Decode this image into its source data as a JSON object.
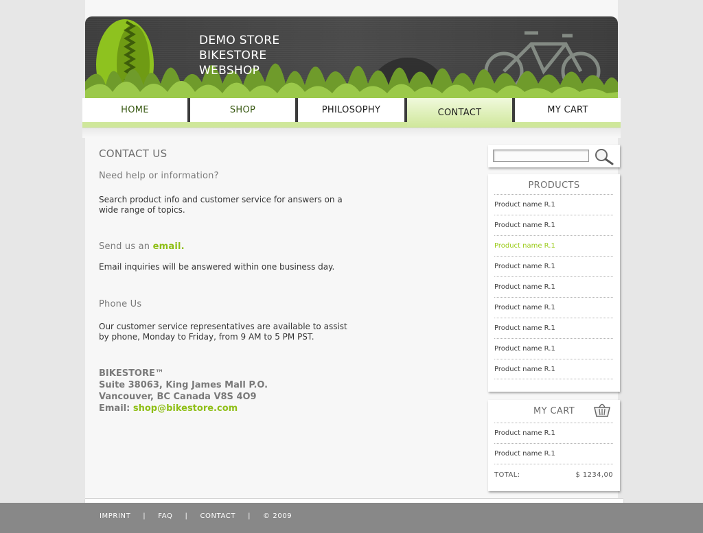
{
  "header": {
    "title_lines": [
      "DEMO STORE",
      "BIKESTORE",
      "WEBSHOP"
    ]
  },
  "nav": {
    "items": [
      {
        "label": "HOME"
      },
      {
        "label": "SHOP"
      },
      {
        "label": "PHILOSOPHY"
      },
      {
        "label": "CONTACT",
        "active": true
      },
      {
        "label": "MY CART"
      }
    ]
  },
  "main": {
    "title": "CONTACT US",
    "help_heading": "Need help or information?",
    "help_text": "Search product info and customer service for answers on a wide range of topics.",
    "email_heading_prefix": "Send us an",
    "email_heading_link": "email.",
    "email_text": "Email inquiries will be answered within one business day.",
    "phone_heading": "Phone Us",
    "phone_text": "Our customer service representatives are available to assist by phone, Monday to Friday, from 9 AM to 5 PM PST.",
    "address": {
      "company": "BIKESTORE™",
      "line1": "Suite 38063, King James Mall P.O.",
      "line2": "Vancouver, BC Canada V8S 4O9",
      "email_label": "Email:",
      "email": "shop@bikestore.com"
    }
  },
  "search": {
    "value": "",
    "icon": "magnifier-icon"
  },
  "products": {
    "title": "PRODUCTS",
    "items": [
      {
        "name": "Product name R.1"
      },
      {
        "name": "Product name R.1"
      },
      {
        "name": "Product name R.1",
        "highlight": true
      },
      {
        "name": "Product name R.1"
      },
      {
        "name": "Product name R.1"
      },
      {
        "name": "Product name R.1"
      },
      {
        "name": "Product name R.1"
      },
      {
        "name": "Product name R.1"
      },
      {
        "name": "Product name R.1"
      }
    ]
  },
  "cart": {
    "title": "MY CART",
    "icon": "basket-icon",
    "items": [
      {
        "name": "Product name R.1"
      },
      {
        "name": "Product name R.1"
      }
    ],
    "total_label": "TOTAL:",
    "total_value": "$ 1234,00"
  },
  "footer": {
    "links": [
      "IMPRINT",
      "FAQ",
      "CONTACT"
    ],
    "copyright": "© 2009"
  },
  "colors": {
    "accent": "#8fbf17",
    "nav_active": "#cfe79a",
    "banner": "#444444",
    "footer": "#888888"
  }
}
